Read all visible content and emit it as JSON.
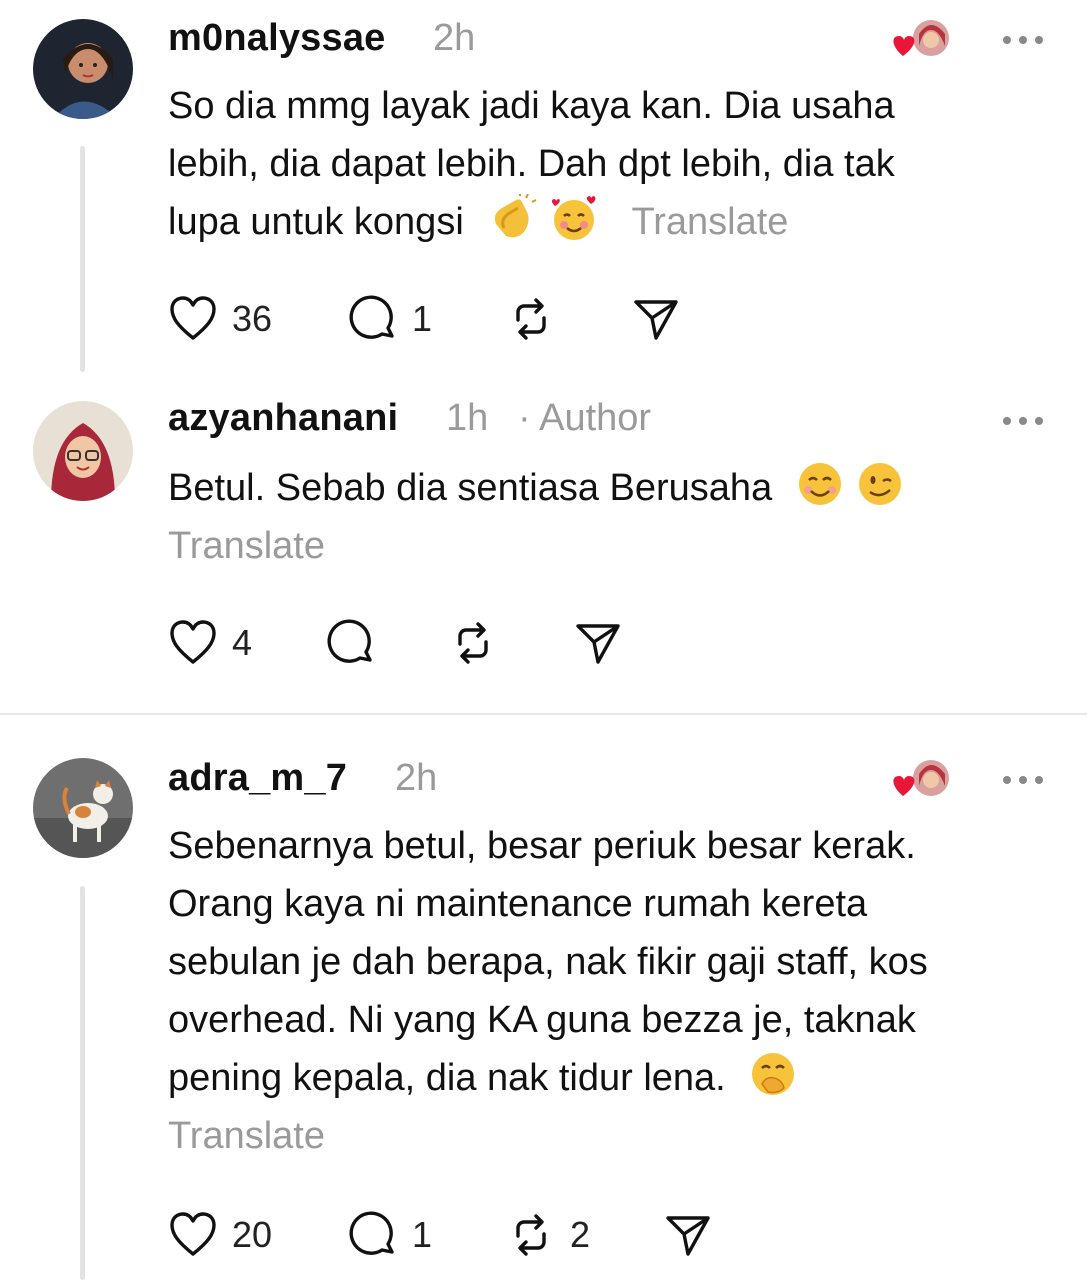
{
  "comments": [
    {
      "username": "m0nalyssae",
      "time": "2h",
      "text_lines": [
        "So dia mmg layak jadi kaya kan. Dia usaha",
        "lebih, dia dapat lebih. Dah dpt lebih, dia tak",
        "lupa untuk kongsi"
      ],
      "translate": "Translate",
      "likes": "36",
      "replies": "1",
      "reposts": "",
      "emojis": [
        "clapping-hands",
        "smiling-face-with-hearts"
      ]
    },
    {
      "username": "azyanhanani",
      "time": "1h",
      "author_label": "· Author",
      "text_lines": [
        "Betul. Sebab dia sentiasa Berusaha"
      ],
      "translate": "Translate",
      "likes": "4",
      "replies": "",
      "reposts": "",
      "emojis": [
        "smiling-face",
        "winking-face"
      ]
    },
    {
      "username": "adra_m_7",
      "time": "2h",
      "text_lines": [
        "Sebenarnya betul, besar periuk besar kerak.",
        "Orang kaya ni maintenance rumah kereta",
        "sebulan je dah berapa, nak fikir gaji staff, kos",
        "overhead. Ni yang KA guna bezza je, taknak",
        "pening kepala, dia nak tidur lena."
      ],
      "translate": "Translate",
      "likes": "20",
      "replies": "1",
      "reposts": "2",
      "emojis": [
        "face-with-hand-over-mouth"
      ]
    }
  ],
  "colors": {
    "muted": "#9a9a9a",
    "heart": "#e8173a",
    "text": "#111111"
  }
}
